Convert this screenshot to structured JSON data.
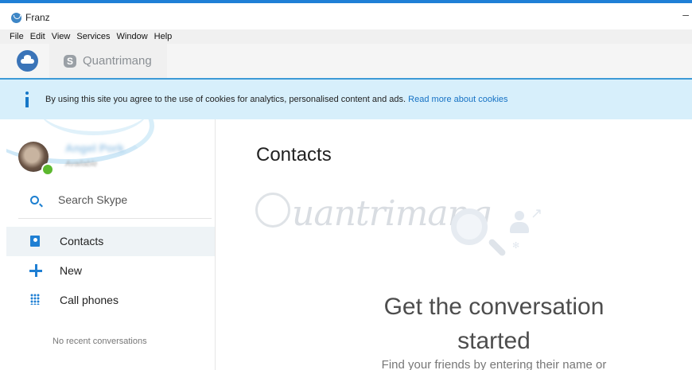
{
  "window": {
    "title": "Franz",
    "minimize_glyph": "–"
  },
  "menu": [
    "File",
    "Edit",
    "View",
    "Services",
    "Window",
    "Help"
  ],
  "service_tab": {
    "name": "Quantrimang",
    "icon": "skype-icon"
  },
  "cookie_banner": {
    "text": "By using this site you agree to the use of cookies for analytics, personalised content and ads.",
    "link": "Read more about cookies"
  },
  "profile": {
    "name": "Angel Pork",
    "status": "Available"
  },
  "search": {
    "label": "Search Skype"
  },
  "nav": [
    {
      "label": "Contacts",
      "icon": "contacts-icon",
      "active": true
    },
    {
      "label": "New",
      "icon": "plus-icon"
    },
    {
      "label": "Call phones",
      "icon": "dialpad-icon"
    }
  ],
  "sidebar_footer": "No recent conversations",
  "main": {
    "title": "Contacts",
    "watermark": "uantrimang",
    "headline_line1": "Get the conversation",
    "headline_line2": "started",
    "subline": "Find your friends by entering their name or"
  },
  "colors": {
    "accent": "#1f7fd3",
    "banner": "#d7effb",
    "presence": "#5cb82e"
  }
}
